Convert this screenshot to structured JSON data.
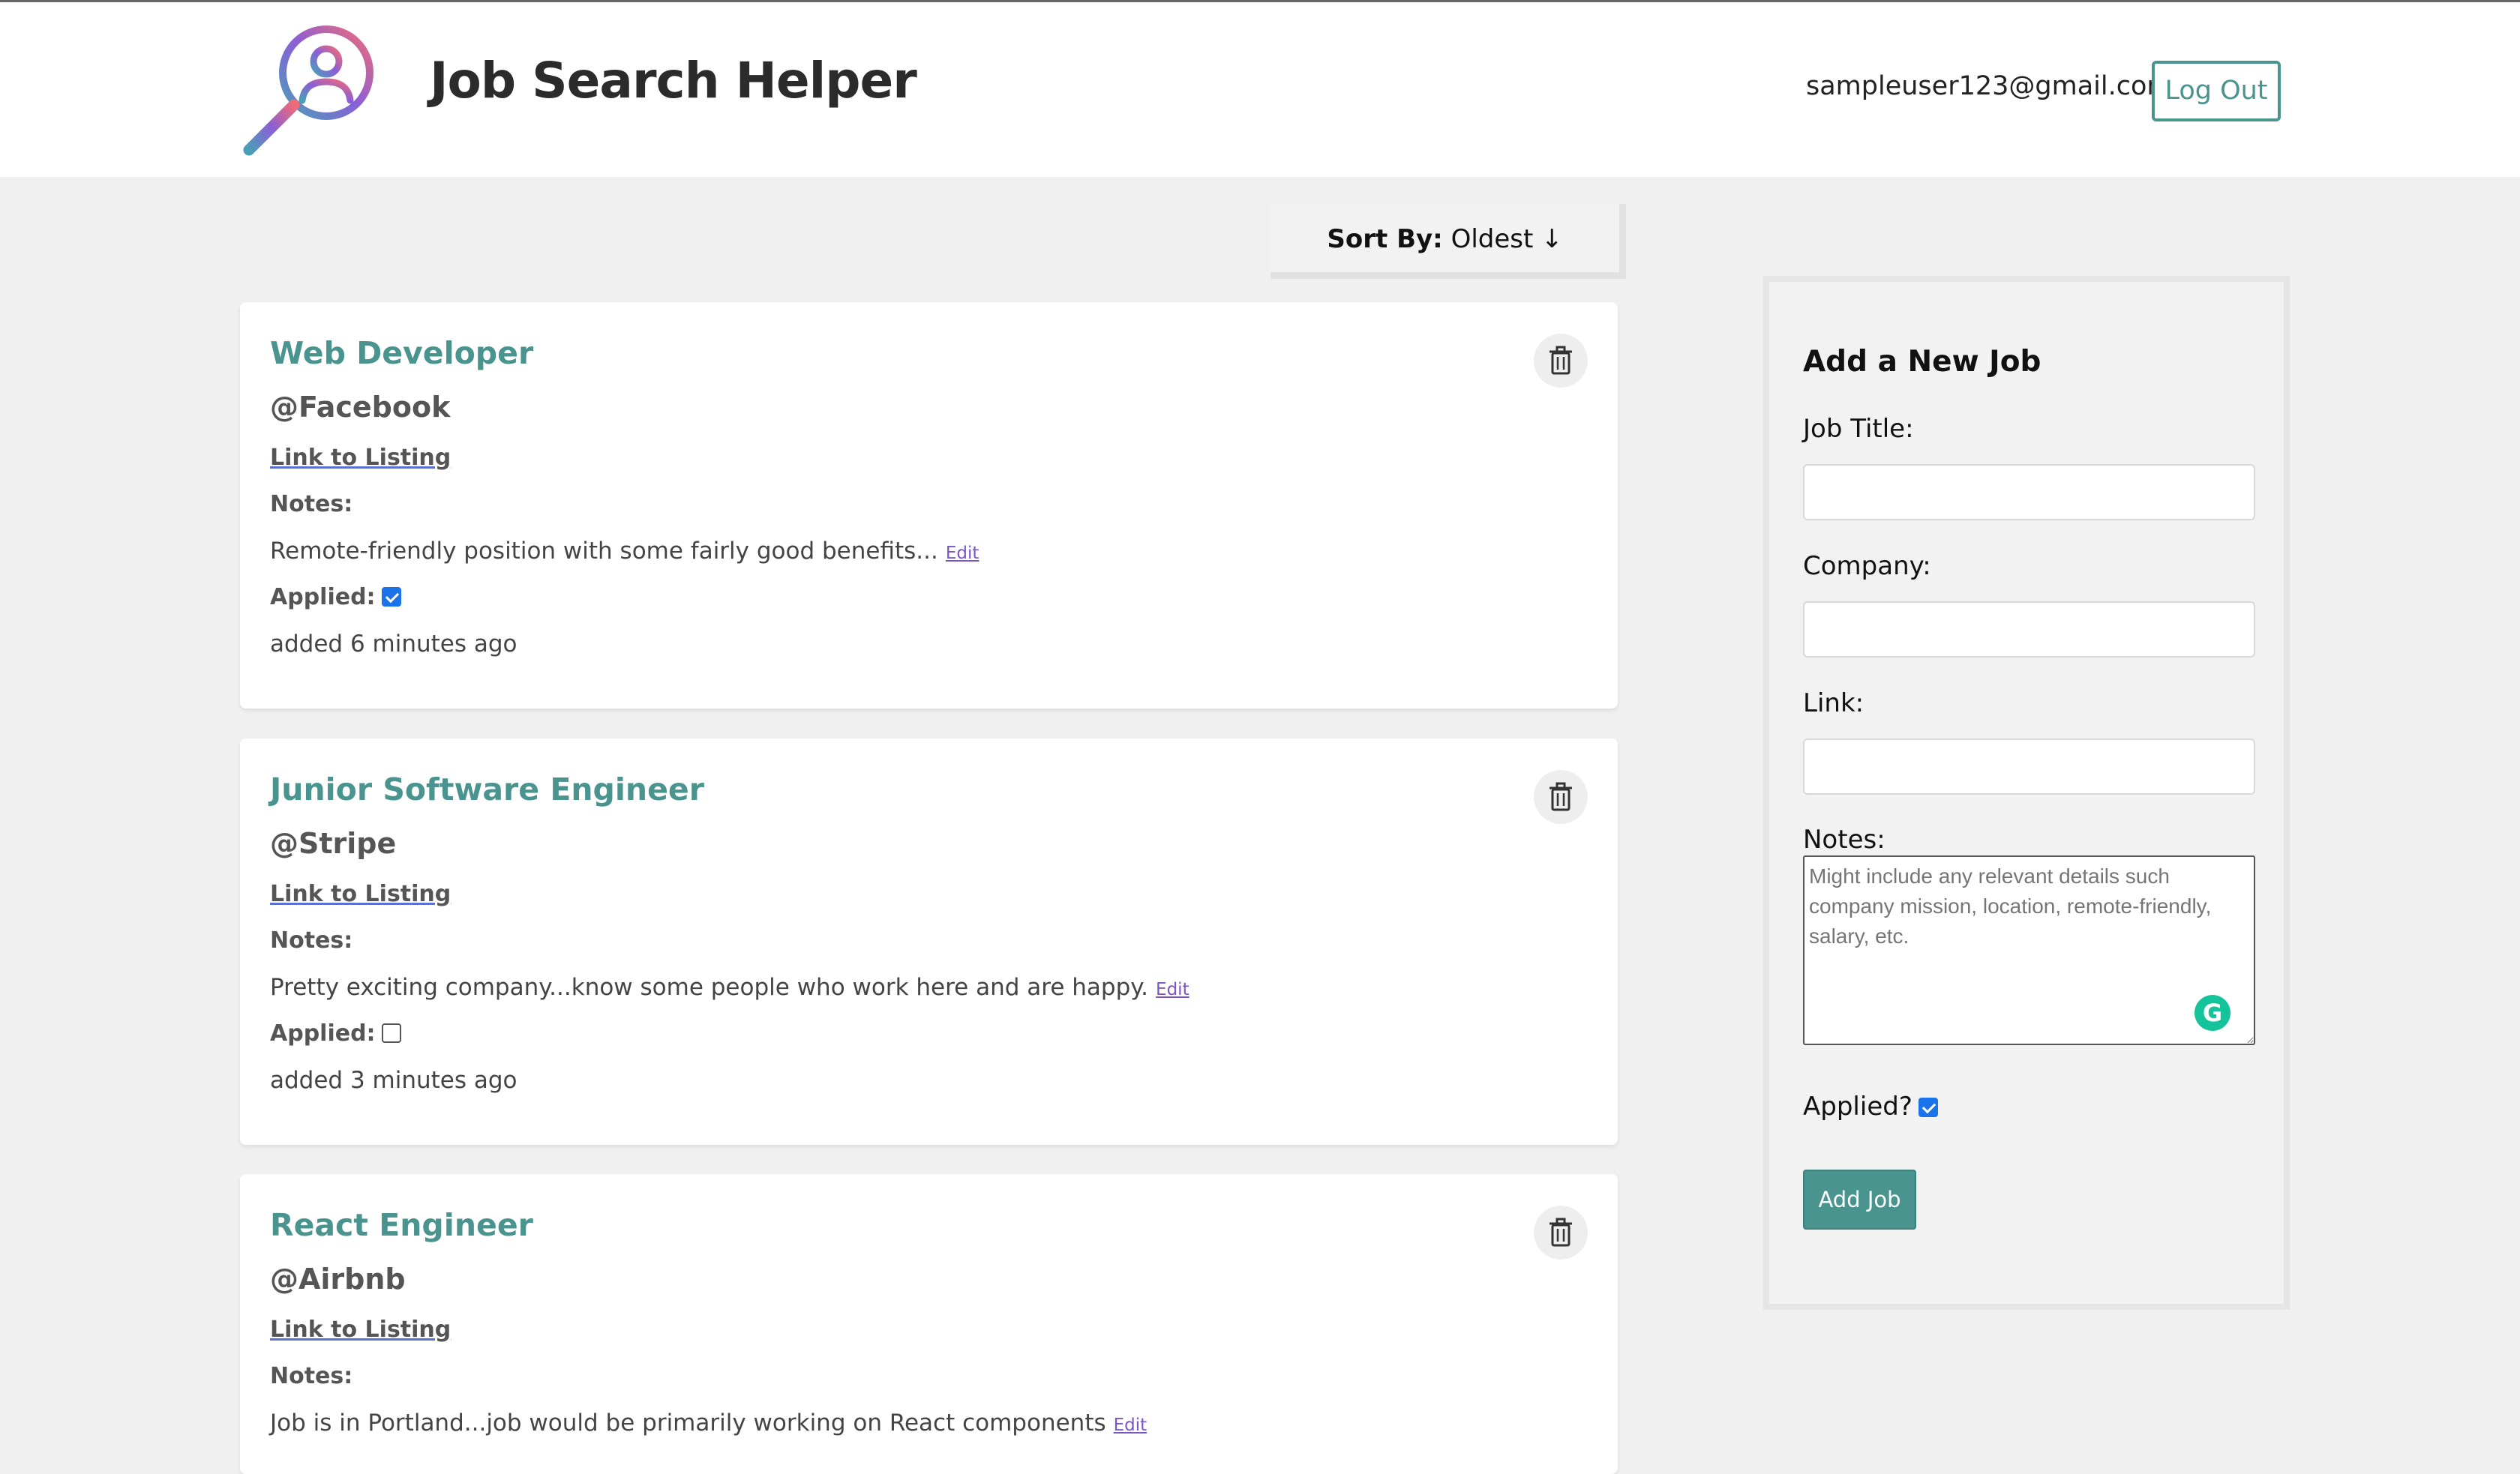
{
  "header": {
    "app_title": "Job Search Helper",
    "logo_icon": "person-magnifier-icon",
    "user_email": "sampleuser123@gmail.com",
    "logout_label": "Log Out"
  },
  "sort": {
    "label": "Sort By:",
    "value": "Oldest ↓"
  },
  "jobs": [
    {
      "title": "Web Developer",
      "company": "@Facebook",
      "link_label": "Link to Listing",
      "notes_label": "Notes:",
      "notes": "Remote-friendly position with some fairly good benefits...",
      "edit_label": "Edit",
      "applied_label": "Applied:",
      "applied": true,
      "added": "added 6 minutes ago"
    },
    {
      "title": "Junior Software Engineer",
      "company": "@Stripe",
      "link_label": "Link to Listing",
      "notes_label": "Notes:",
      "notes": "Pretty exciting company...know some people who work here and are happy.",
      "edit_label": "Edit",
      "applied_label": "Applied:",
      "applied": false,
      "added": "added 3 minutes ago"
    },
    {
      "title": "React Engineer",
      "company": "@Airbnb",
      "link_label": "Link to Listing",
      "notes_label": "Notes:",
      "notes": "Job is in Portland...job would be primarily working on React components",
      "edit_label": "Edit"
    }
  ],
  "form": {
    "title": "Add a New Job",
    "job_title_label": "Job Title:",
    "company_label": "Company:",
    "link_label": "Link:",
    "notes_label": "Notes:",
    "notes_placeholder": "Might include any relevant details such company mission, location, remote-friendly, salary, etc.",
    "applied_label": "Applied?",
    "applied": true,
    "submit_label": "Add Job"
  },
  "colors": {
    "accent": "#4a9490",
    "background": "#f0f0f0",
    "checkbox": "#1a73e8",
    "edit_link": "#7a55c9"
  }
}
